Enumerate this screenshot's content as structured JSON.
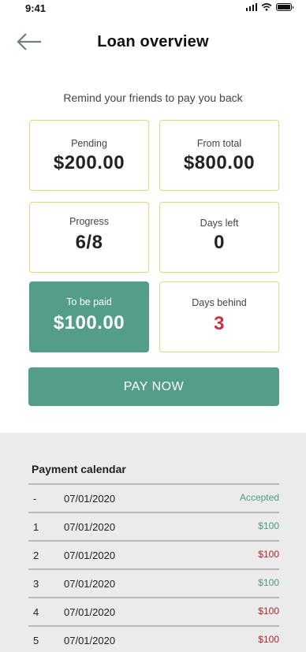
{
  "status_bar": {
    "time": "9:41"
  },
  "header": {
    "title": "Loan overview"
  },
  "subtitle": "Remind your friends to pay you back",
  "cards": {
    "pending": {
      "label": "Pending",
      "value": "$200.00"
    },
    "from_total": {
      "label": "From total",
      "value": "$800.00"
    },
    "progress": {
      "label": "Progress",
      "value": "6/8"
    },
    "days_left": {
      "label": "Days left",
      "value": "0"
    },
    "to_be_paid": {
      "label": "To be paid",
      "value": "$100.00"
    },
    "days_behind": {
      "label": "Days behind",
      "value": "3"
    }
  },
  "pay_button": {
    "label": "PAY NOW"
  },
  "calendar": {
    "title": "Payment calendar",
    "rows": [
      {
        "index": "-",
        "date": "07/01/2020",
        "status": "Accepted",
        "status_color": "#4d9c85"
      },
      {
        "index": "1",
        "date": "07/01/2020",
        "status": "$100",
        "status_color": "#4d9c85"
      },
      {
        "index": "2",
        "date": "07/01/2020",
        "status": "$100",
        "status_color": "#b3252a"
      },
      {
        "index": "3",
        "date": "07/01/2020",
        "status": "$100",
        "status_color": "#4d9c85"
      },
      {
        "index": "4",
        "date": "07/01/2020",
        "status": "$100",
        "status_color": "#b3252a"
      },
      {
        "index": "5",
        "date": "07/01/2020",
        "status": "$100",
        "status_color": "#b3252a"
      }
    ]
  },
  "colors": {
    "accent": "#549d89",
    "card_border": "#e6d57a",
    "danger": "#c8323a",
    "calendar_bg": "#ebebeb"
  }
}
